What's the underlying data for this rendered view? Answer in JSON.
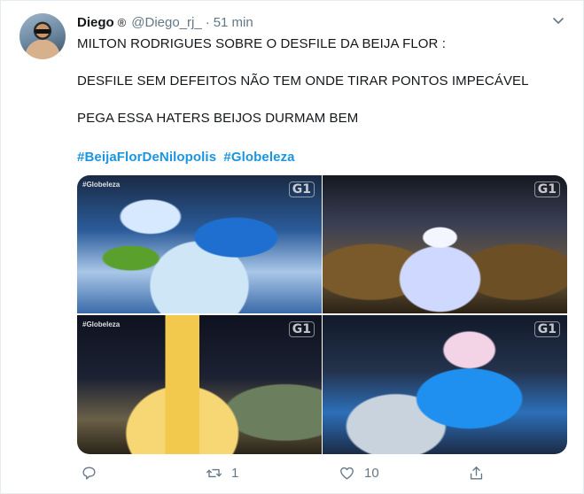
{
  "tweet": {
    "display_name": "Diego",
    "badge": "®",
    "handle": "@Diego_rj_",
    "separator": "·",
    "time": "51 min",
    "lines": [
      "MILTON RODRIGUES SOBRE O DESFILE DA BEIJA FLOR :",
      "DESFILE SEM DEFEITOS NÃO TEM ONDE TIRAR PONTOS IMPECÁVEL",
      "PEGA ESSA HATERS BEIJOS DURMAM BEM"
    ],
    "hashtags": [
      "#BeijaFlorDeNilopolis",
      "#Globeleza"
    ],
    "media": [
      {
        "watermark": "#Globeleza",
        "logo": "G1"
      },
      {
        "watermark": "",
        "logo": "G1"
      },
      {
        "watermark": "#Globeleza",
        "logo": "G1"
      },
      {
        "watermark": "",
        "logo": "G1"
      }
    ],
    "actions": {
      "reply_count": "",
      "retweet_count": "1",
      "like_count": "10"
    }
  },
  "colors": {
    "link": "#1b95e0",
    "muted": "#657786",
    "text": "#14171a"
  },
  "icons": {
    "menu": "chevron-down-icon",
    "reply": "reply-icon",
    "retweet": "retweet-icon",
    "like": "heart-icon",
    "share": "share-icon"
  }
}
